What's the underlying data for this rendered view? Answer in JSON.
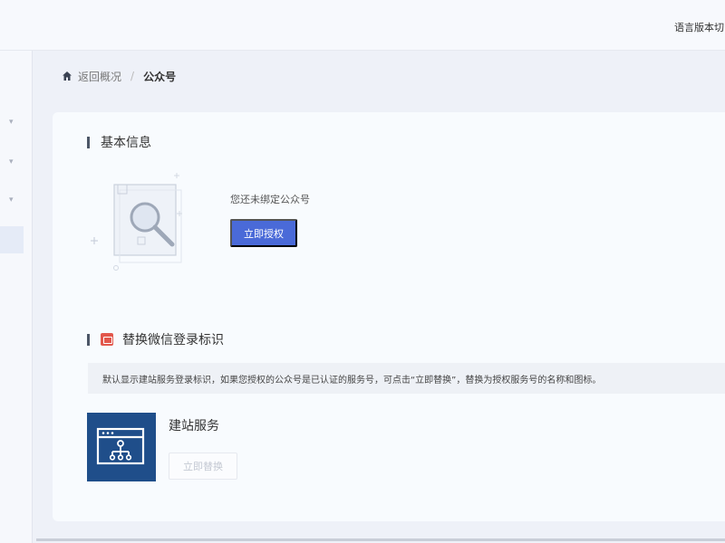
{
  "topbar": {
    "language_label": "语言版本切"
  },
  "breadcrumb": {
    "back_label": "返回概况",
    "separator": "/",
    "current": "公众号"
  },
  "basic_info": {
    "title": "基本信息",
    "unbound_text": "您还未绑定公众号",
    "authorize_button": "立即授权"
  },
  "login_logo": {
    "title": "替换微信登录标识",
    "notice": "默认显示建站服务登录标识，如果您授权的公众号是已认证的服务号，可点击“立即替换”，替换为授权服务号的名称和图标。",
    "service_name": "建站服务",
    "replace_button": "立即替换"
  },
  "icons": {
    "home": "home-icon",
    "illustration": "document-search-icon",
    "wechat_badge": "wechat-badge-icon",
    "service_logo": "site-service-logo"
  },
  "colors": {
    "primary": "#4a6ad8",
    "logo_bg": "#1f4e8a",
    "badge": "#e2574c"
  }
}
